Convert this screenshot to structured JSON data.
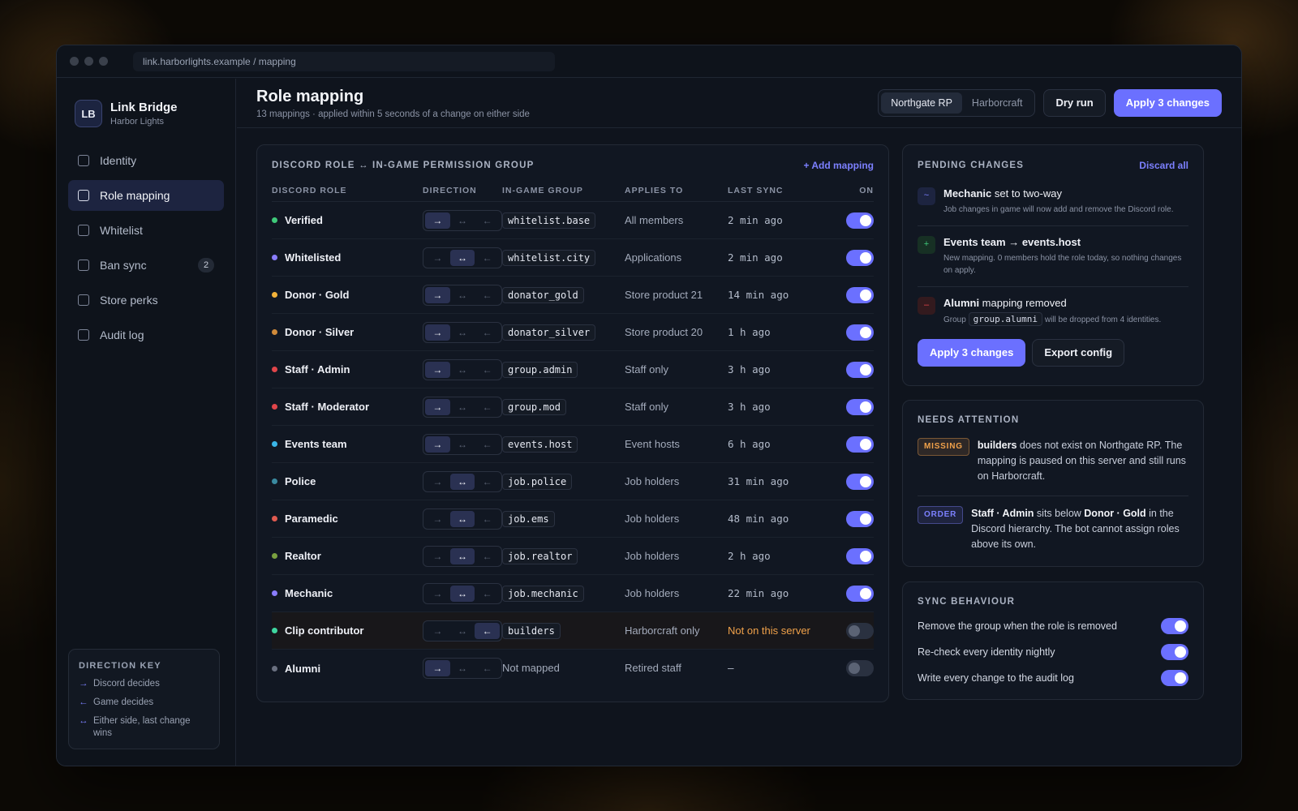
{
  "window": {
    "url": "link.harborlights.example / mapping"
  },
  "brand": {
    "initials": "LB",
    "name": "Link Bridge",
    "sub": "Harbor Lights"
  },
  "nav": [
    {
      "label": "Identity"
    },
    {
      "label": "Role mapping"
    },
    {
      "label": "Whitelist"
    },
    {
      "label": "Ban sync",
      "badge": "2"
    },
    {
      "label": "Store perks"
    },
    {
      "label": "Audit log"
    }
  ],
  "key": {
    "title": "DIRECTION KEY",
    "items": [
      {
        "arrow": "→",
        "text": "Discord decides"
      },
      {
        "arrow": "←",
        "text": "Game decides"
      },
      {
        "arrow": "↔",
        "text": "Either side, last change wins"
      }
    ]
  },
  "header": {
    "title": "Role mapping",
    "subtitle": "13 mappings · applied within 5 seconds of a change on either side",
    "servers": [
      "Northgate RP",
      "Harborcraft"
    ],
    "dry_run": "Dry run",
    "apply": "Apply 3 changes"
  },
  "table": {
    "title": "DISCORD ROLE ↔ IN-GAME PERMISSION GROUP",
    "add": "+ Add mapping",
    "columns": [
      "DISCORD ROLE",
      "DIRECTION",
      "IN-GAME GROUP",
      "APPLIES TO",
      "LAST SYNC",
      "ON"
    ],
    "rows": [
      {
        "role": "Verified",
        "color": "#3fc97a",
        "dir": "to_game",
        "group": "whitelist.base",
        "applies": "All members",
        "sync": "2 min ago",
        "on": true
      },
      {
        "role": "Whitelisted",
        "color": "#8a7dff",
        "dir": "both",
        "group": "whitelist.city",
        "applies": "Applications",
        "sync": "2 min ago",
        "on": true
      },
      {
        "role": "Donor · Gold",
        "color": "#f2b23a",
        "dir": "to_game",
        "group": "donator_gold",
        "applies": "Store product 21",
        "sync": "14 min ago",
        "on": true
      },
      {
        "role": "Donor · Silver",
        "color": "#d08a3a",
        "dir": "to_game",
        "group": "donator_silver",
        "applies": "Store product 20",
        "sync": "1 h ago",
        "on": true
      },
      {
        "role": "Staff · Admin",
        "color": "#e0454a",
        "dir": "to_game",
        "group": "group.admin",
        "applies": "Staff only",
        "sync": "3 h ago",
        "on": true
      },
      {
        "role": "Staff · Moderator",
        "color": "#e0454a",
        "dir": "to_game",
        "group": "group.mod",
        "applies": "Staff only",
        "sync": "3 h ago",
        "on": true
      },
      {
        "role": "Events team",
        "color": "#3ab6e8",
        "dir": "to_game",
        "group": "events.host",
        "applies": "Event hosts",
        "sync": "6 h ago",
        "on": true
      },
      {
        "role": "Police",
        "color": "#3a8aa0",
        "dir": "both",
        "group": "job.police",
        "applies": "Job holders",
        "sync": "31 min ago",
        "on": true
      },
      {
        "role": "Paramedic",
        "color": "#e05a50",
        "dir": "both",
        "group": "job.ems",
        "applies": "Job holders",
        "sync": "48 min ago",
        "on": true
      },
      {
        "role": "Realtor",
        "color": "#7aa040",
        "dir": "both",
        "group": "job.realtor",
        "applies": "Job holders",
        "sync": "2 h ago",
        "on": true
      },
      {
        "role": "Mechanic",
        "color": "#8a7dff",
        "dir": "both",
        "group": "job.mechanic",
        "applies": "Job holders",
        "sync": "22 min ago",
        "on": true
      },
      {
        "role": "Clip contributor",
        "color": "#3fd6a0",
        "dir": "to_discord",
        "group": "builders",
        "applies": "Harborcraft only",
        "sync": "Not on this server",
        "on": false,
        "warn": true
      },
      {
        "role": "Alumni",
        "color": "#6a7080",
        "dir": "to_game",
        "group": "Not mapped",
        "plain_group": true,
        "applies": "Retired staff",
        "sync": "—",
        "on": false
      }
    ]
  },
  "pending": {
    "title": "PENDING CHANGES",
    "discard": "Discard all",
    "items": [
      {
        "icon": "~",
        "icon_color": "#7c80ff",
        "icon_bg": "#1d2440",
        "bold": "Mechanic",
        "rest": " set to two-way",
        "desc": "Job changes in game will now add and remove the Discord role."
      },
      {
        "icon": "+",
        "icon_color": "#3fc97a",
        "icon_bg": "#173024",
        "bold": "Events team → events.host",
        "rest": "",
        "desc": "New mapping. 0 members hold the role today, so nothing changes on apply."
      },
      {
        "icon": "–",
        "icon_color": "#e0454a",
        "icon_bg": "#331a1e",
        "bold": "Alumni",
        "rest": " mapping removed",
        "desc_pre": "Group ",
        "desc_code": "group.alumni",
        "desc_post": " will be dropped from 4 identities."
      }
    ],
    "apply": "Apply 3 changes",
    "export": "Export config"
  },
  "attention": {
    "title": "NEEDS ATTENTION",
    "items": [
      {
        "tag": "MISSING",
        "tag_color": "#f0a14a",
        "parts": [
          [
            "b",
            "builders"
          ],
          [
            "t",
            " does not exist on Northgate RP. The mapping is paused on this server and still runs on Harborcraft."
          ]
        ]
      },
      {
        "tag": "ORDER",
        "tag_color": "#7c80ff",
        "parts": [
          [
            "b",
            "Staff · Admin"
          ],
          [
            "t",
            " sits below "
          ],
          [
            "b",
            "Donor · Gold"
          ],
          [
            "t",
            " in the Discord hierarchy. The bot cannot assign roles above its own."
          ]
        ]
      }
    ]
  },
  "sync": {
    "title": "SYNC BEHAVIOUR",
    "items": [
      {
        "label": "Remove the group when the role is removed",
        "on": true
      },
      {
        "label": "Re-check every identity nightly",
        "on": true
      },
      {
        "label": "Write every change to the audit log",
        "on": true
      }
    ]
  }
}
